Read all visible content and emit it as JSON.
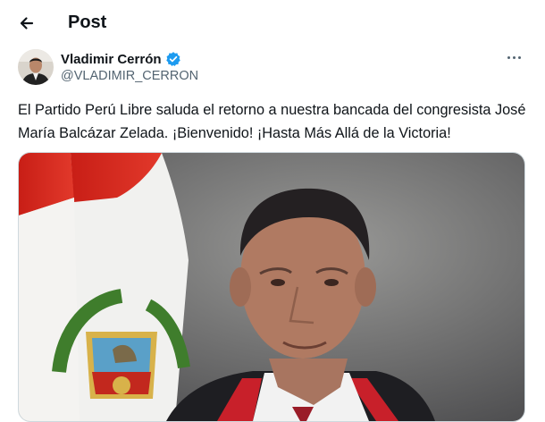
{
  "header": {
    "title": "Post",
    "back_icon": "arrow-left-icon"
  },
  "tweet": {
    "author": {
      "name": "Vladimir Cerrón",
      "handle": "@VLADIMIR_CERRON",
      "verified_badge": "verified-badge-icon",
      "verified_color": "#1d9bf0"
    },
    "text": "El Partido Perú Libre saluda el retorno a nuestra bancada del congresista José María Balcázar Zelada. ¡Bienvenido! ¡Hasta Más Allá de la Victoria!",
    "more_icon": "more-horizontal-icon"
  },
  "colors": {
    "text": "#0f1419",
    "secondary": "#536471",
    "flag_red": "#d52b1e"
  }
}
